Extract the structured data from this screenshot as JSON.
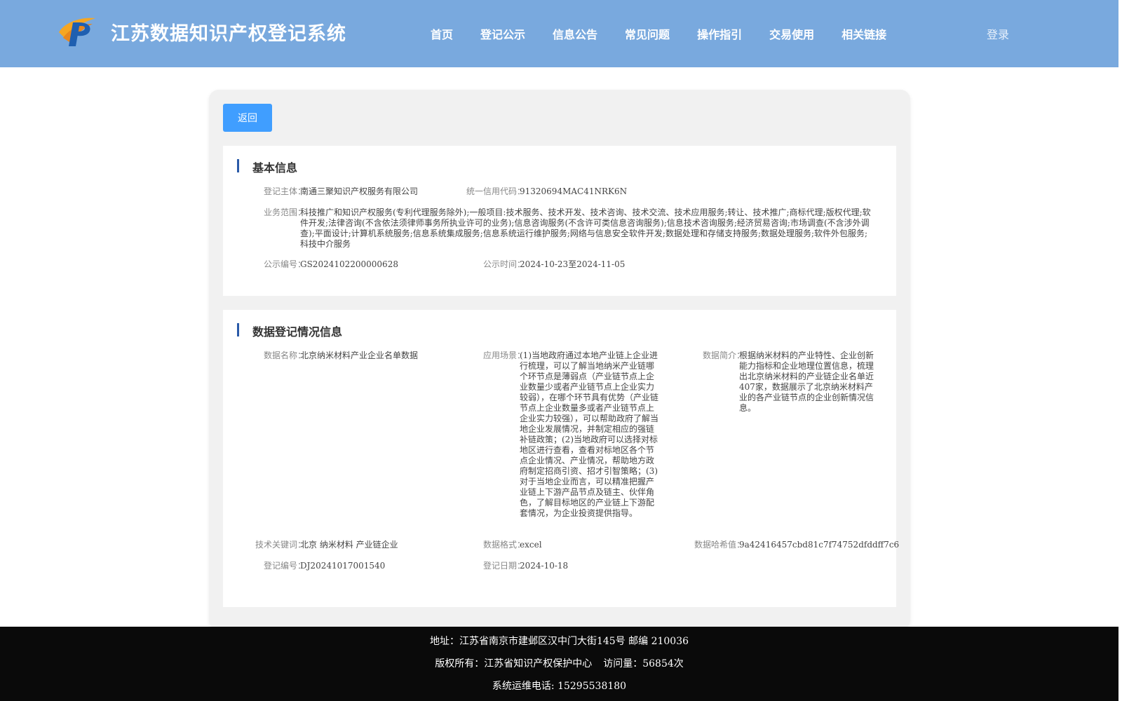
{
  "header": {
    "title": "江苏数据知识产权登记系统",
    "nav": [
      "首页",
      "登记公示",
      "信息公告",
      "常见问题",
      "操作指引",
      "交易使用",
      "相关链接"
    ],
    "login_label": "登录"
  },
  "main": {
    "back_label": "返回",
    "basic": {
      "section_title": "基本信息",
      "entity_label": "登记主体：",
      "entity_value": "南通三聚知识产权服务有限公司",
      "credit_label": "统一信用代码：",
      "credit_value": "91320694MAC41NRK6N",
      "scope_label": "业务范围：",
      "scope_value": "科技推广和知识产权服务(专利代理服务除外);一般项目:技术服务、技术开发、技术咨询、技术交流、技术应用服务;转让、技术推广;商标代理;版权代理;软件开发;法律咨询(不含依法须律师事务所执业许可的业务);信息咨询服务(不含许可类信息咨询服务);信息技术咨询服务;经济贸易咨询;市场调查(不含涉外调查);平面设计;计算机系统服务;信息系统集成服务;信息系统运行维护服务;网络与信息安全软件开发;数据处理和存储支持服务;数据处理服务;软件外包服务;科技中介服务",
      "pubno_label": "公示编号：",
      "pubno_value": "GS2024102200000628",
      "pubtime_label": "公示时间：",
      "pubtime_value": "2024-10-23至2024-11-05"
    },
    "data_reg": {
      "section_title": "数据登记情况信息",
      "name_label": "数据名称：",
      "name_value": "北京纳米材料产业企业名单数据",
      "scene_label": "应用场景：",
      "scene_value": "(1)当地政府通过本地产业链上企业进行梳理，可以了解当地纳米产业链哪个环节点是薄弱点（产业链节点上企业数量少或者产业链节点上企业实力较弱），在哪个环节具有优势（产业链节点上企业数量多或者产业链节点上企业实力较强），可以帮助政府了解当地企业发展情况，并制定相应的强链补链政策；(2)当地政府可以选择对标地区进行查看，查看对标地区各个节点企业情况、产业情况，帮助地方政府制定招商引资、招才引智策略；(3)对于当地企业而言，可以精准把握产业链上下游产品节点及链主、伙伴角色，了解目标地区的产业链上下游配套情况，为企业投资提供指导。",
      "intro_label": "数据简介：",
      "intro_value": "根据纳米材料的产业特性、企业创新能力指标和企业地理位置信息，梳理出北京纳米材料的产业链企业名单近407家，数据展示了北京纳米材料产业的各产业链节点的企业创新情况信息。",
      "keywords_label": "技术关键词：",
      "keywords_value": "北京 纳米材料 产业链企业",
      "format_label": "数据格式：",
      "format_value": "excel",
      "hash_label": "数据哈希值：",
      "hash_value": "9a42416457cbd81c7f74752dfddff7c6",
      "regno_label": "登记编号：",
      "regno_value": "DJ20241017001540",
      "regdate_label": "登记日期：",
      "regdate_value": "2024-10-18"
    }
  },
  "footer": {
    "address": "地址：江苏省南京市建邺区汉中门大街145号 邮编 210036",
    "copyright": "版权所有：江苏省知识产权保护中心",
    "visits": "访问量：56854次",
    "phone": "系统运维电话: 15295538180"
  },
  "colors": {
    "header_bg": "#79a9de",
    "button": "#409eff",
    "section_bar": "#2a5aa8",
    "footer_bg": "#0a0a0a"
  }
}
